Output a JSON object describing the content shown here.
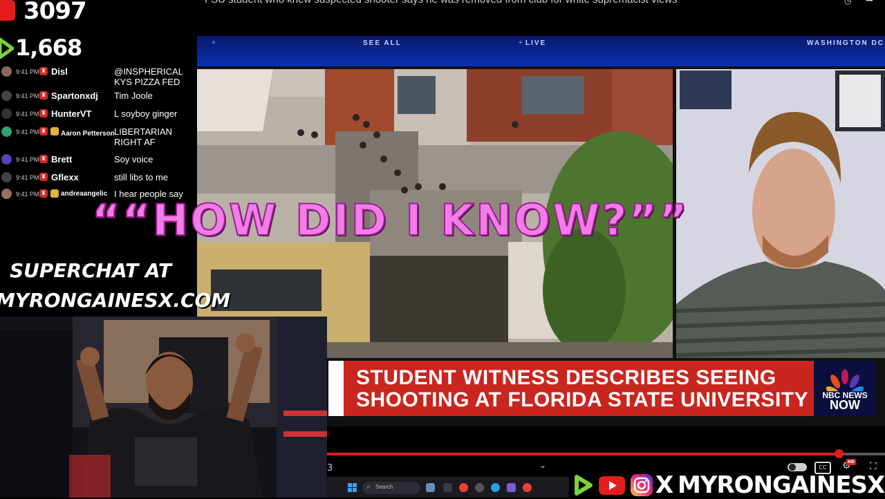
{
  "video": {
    "title": "FSU student who knew suspected shooter says he was removed from club for white supremacist views"
  },
  "stream_stats": {
    "viewer_count": "3097",
    "rumble_count": "1,668"
  },
  "broadcast": {
    "top_bar": {
      "see_all": "SEE ALL",
      "live": "LIVE",
      "location": "WASHINGTON DC"
    },
    "chyron": {
      "line1": "STUDENT WITNESS DESCRIBES SEEING",
      "line2": "SHOOTING AT FLORIDA STATE UNIVERSITY"
    },
    "network": {
      "name": "NBC NEWS",
      "brand": "NOW"
    }
  },
  "chat": {
    "messages": [
      {
        "time": "9:41 PM",
        "user": "Disl",
        "text": "@INSPHERICAL KYS PIZZA FED",
        "avatar_color": "#8a6b5a"
      },
      {
        "time": "9:41 PM",
        "user": "Spartonxdj",
        "text": "Tim Joole",
        "avatar_color": "#444444"
      },
      {
        "time": "9:41 PM",
        "user": "HunterVT",
        "text": "L soyboy ginger",
        "avatar_color": "#333333"
      },
      {
        "time": "9:41 PM",
        "user": "Aaron Petterson",
        "text": "LIBERTARIAN RIGHT AF",
        "avatar_color": "#2fa36b"
      },
      {
        "time": "9:41 PM",
        "user": "Brett",
        "text": "Soy voice",
        "avatar_color": "#5b3fb8"
      },
      {
        "time": "9:41 PM",
        "user": "Gflexx",
        "text": "still libs to me",
        "avatar_color": "#444444"
      },
      {
        "time": "9:41 PM",
        "user": "andreaangelic",
        "text": "I hear people say",
        "avatar_color": "#9a7060"
      }
    ]
  },
  "overlay": {
    "caption": "““HOW DID I KNOW?””",
    "superchat_line1": "SUPERCHAT AT",
    "superchat_line2": "MYRONGAINESX.COM"
  },
  "player": {
    "progress_fraction": 0.917,
    "left_number": "3",
    "chevron": "⌄",
    "cc_label": "CC",
    "hd_badge": "HD"
  },
  "taskbar": {
    "search_placeholder": "Search"
  },
  "social": {
    "x_glyph": "X",
    "handle": "MYRONGAINESX"
  },
  "colors": {
    "accent_red": "#e21d1d",
    "overlay_pink": "#f27de8",
    "chyron_red": "#c9261f"
  }
}
